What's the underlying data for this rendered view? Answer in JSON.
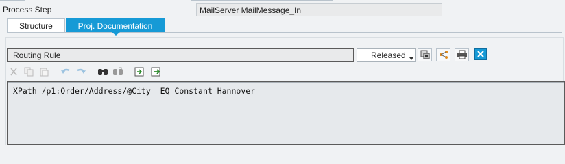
{
  "header": {
    "process_step_label": "Process Step",
    "process_step_value": "MailServer MailMessage_In"
  },
  "tabs": [
    {
      "label": "Structure",
      "active": false
    },
    {
      "label": "Proj. Documentation",
      "active": true
    }
  ],
  "routing": {
    "rule_label": "Routing Rule",
    "status_value": "Released"
  },
  "right_toolbar": {
    "icons": [
      "settings-export-icon",
      "network-icon",
      "print-icon",
      "close-icon"
    ]
  },
  "edit_toolbar": {
    "icons": [
      "cut-icon",
      "copy-icon",
      "paste-icon",
      "undo-icon",
      "redo-icon",
      "find-icon",
      "find-next-icon",
      "upload-icon",
      "download-icon"
    ]
  },
  "editor": {
    "content": "XPath /p1:Order/Address/@City  EQ Constant Hannover"
  },
  "colors": {
    "accent": "#169ad6",
    "field_bg": "#e9eaeb"
  }
}
